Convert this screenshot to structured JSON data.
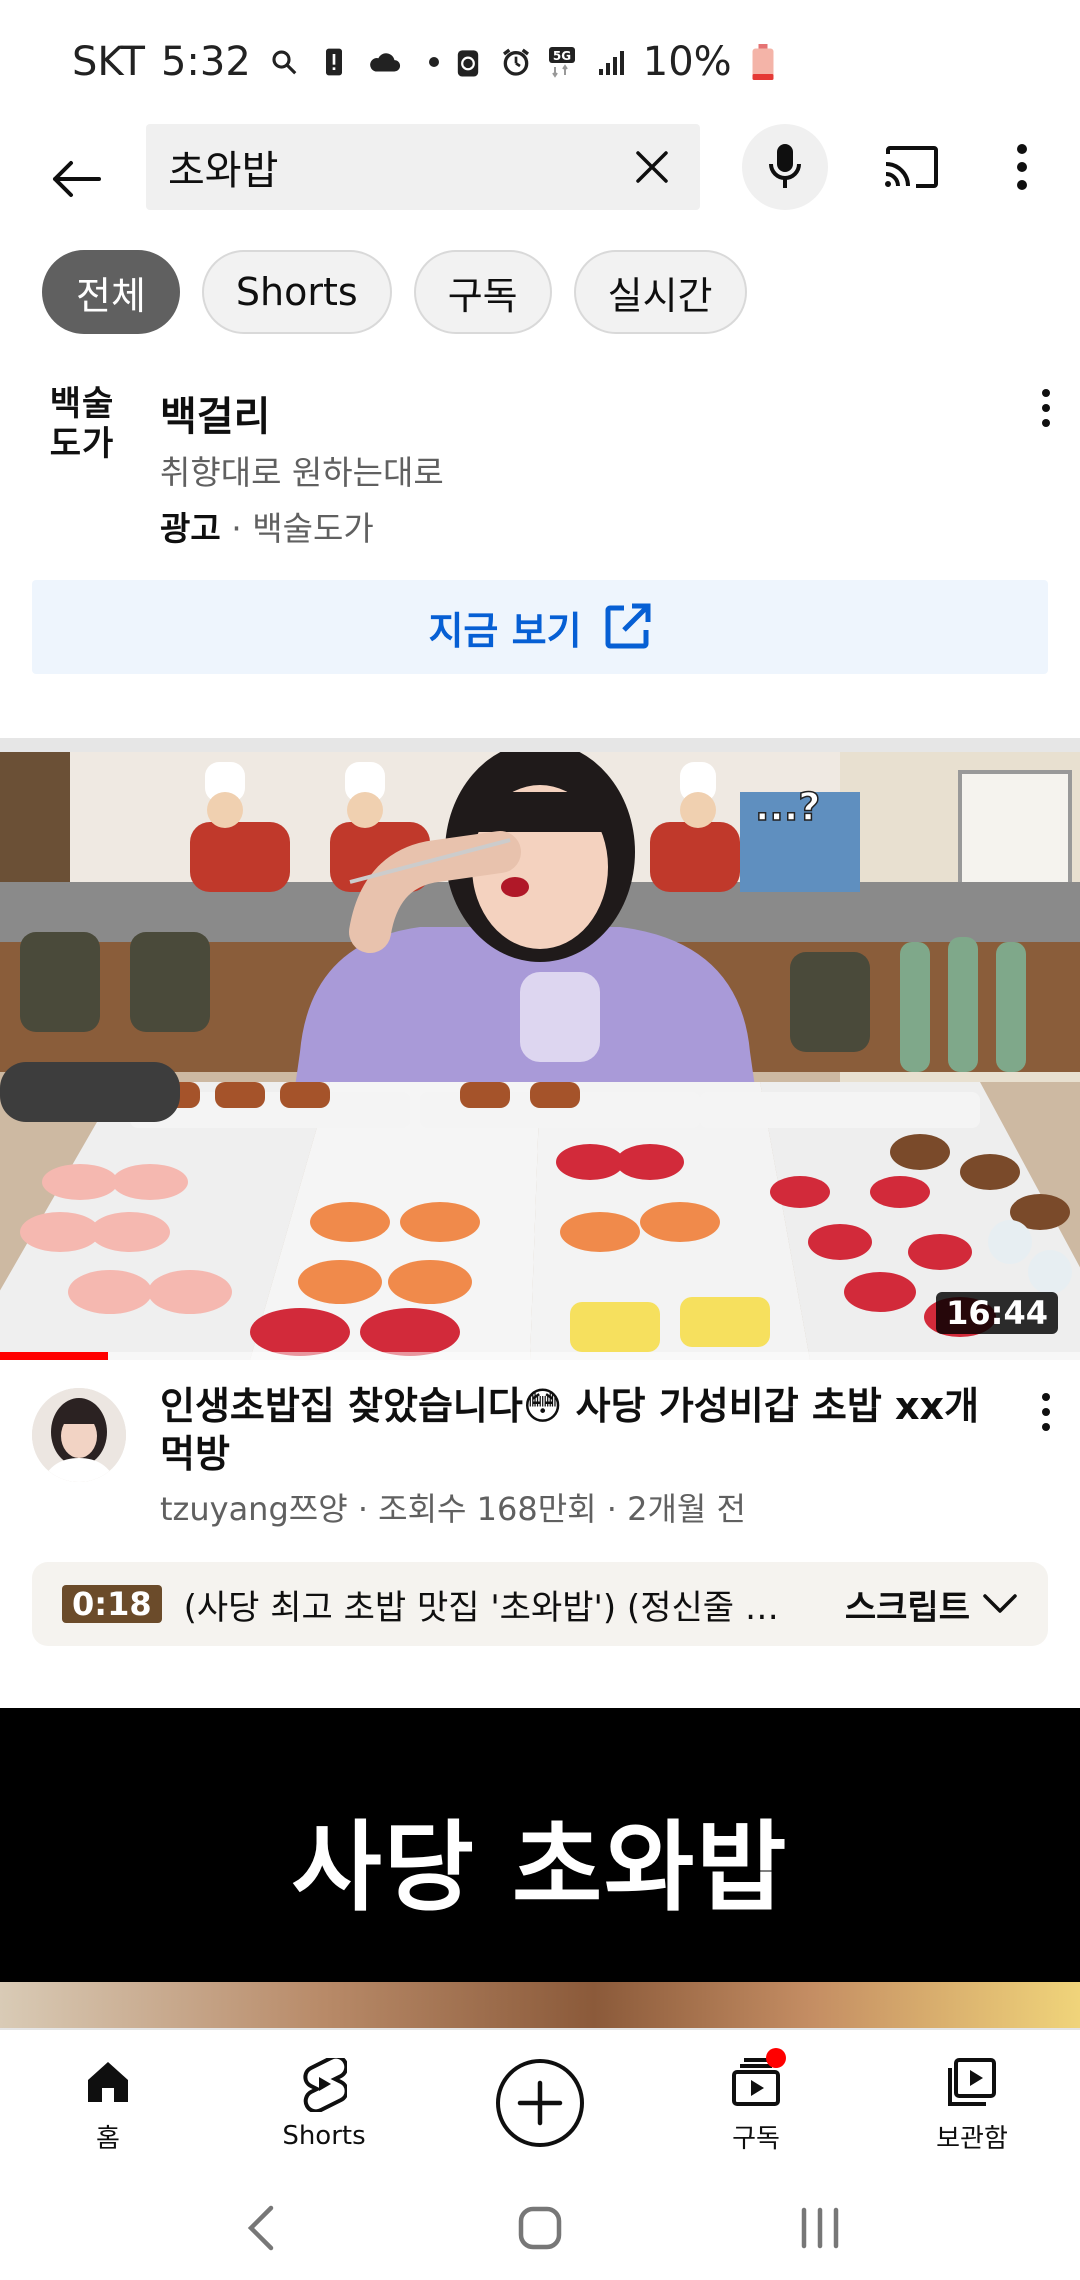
{
  "status_bar": {
    "carrier": "SKT",
    "time": "5:32",
    "network": "5G",
    "battery": "10%"
  },
  "search": {
    "query": "초와밥"
  },
  "chips": [
    {
      "label": "전체",
      "active": true
    },
    {
      "label": "Shorts",
      "active": false
    },
    {
      "label": "구독",
      "active": false
    },
    {
      "label": "실시간",
      "active": false
    }
  ],
  "ad": {
    "logo_text_line1": "백술",
    "logo_text_line2": "도가",
    "title": "백걸리",
    "subtitle": "취향대로 원하는대로",
    "label": "광고",
    "separator": "·",
    "advertiser": "백술도가",
    "cta": "지금 보기"
  },
  "video1": {
    "duration": "16:44",
    "watched_fraction": 0.1,
    "title": "인생초밥집 찾았습니다😳 사당 가성비갑 초밥 xx개 먹방",
    "meta": "tzuyang쯔양 · 조회수 168만회 · 2개월 전",
    "thumb_caption": "...?"
  },
  "transcript": {
    "time": "0:18",
    "text": "(사당 최고 초밥 맛집 '초와밥') (정신줄 놓...",
    "button": "스크립트"
  },
  "video2": {
    "thumb_text": "사당 초와밥"
  },
  "bottom_nav": {
    "home": "홈",
    "shorts": "Shorts",
    "subscriptions": "구독",
    "library": "보관함"
  },
  "colors": {
    "accent_red": "#ff0000",
    "cta_blue": "#065fd4",
    "chip_active": "#606060"
  }
}
